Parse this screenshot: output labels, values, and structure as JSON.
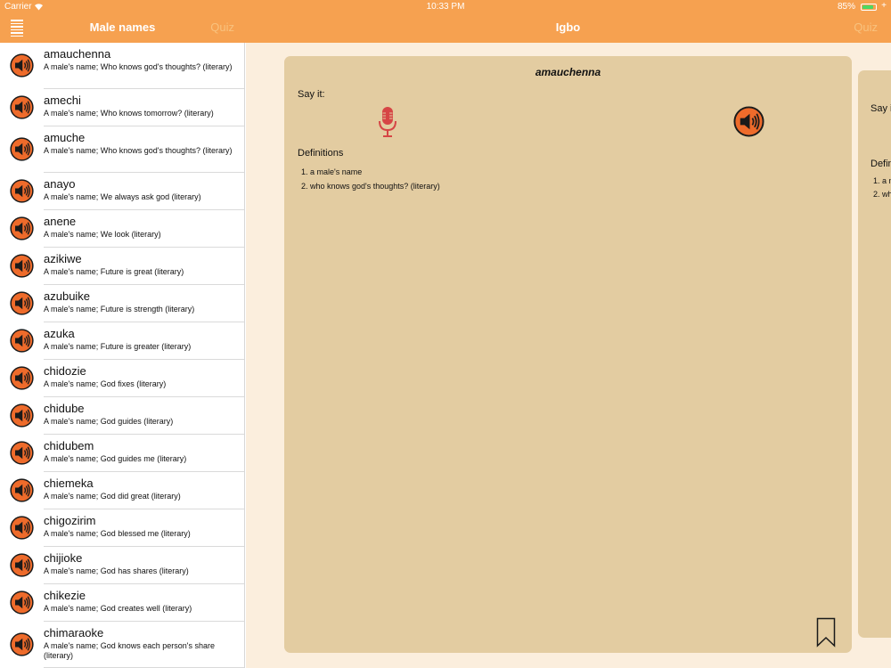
{
  "status_bar": {
    "carrier": "Carrier",
    "time": "10:33 PM",
    "battery": "85%",
    "battery_level": 0.85
  },
  "master": {
    "title": "Male names",
    "quiz_label": "Quiz"
  },
  "detail": {
    "title": "Igbo",
    "quiz_label": "Quiz"
  },
  "colors": {
    "accent": "#f6a150",
    "card": "#e3cca1",
    "detail_bg": "#fbeedd",
    "mic": "#d64545",
    "speaker": "#ee6b2b",
    "battery": "#4cd964"
  },
  "names": [
    {
      "name": "amauchenna",
      "desc": "A male's name; Who knows god's thoughts? (literary)"
    },
    {
      "name": "amechi",
      "desc": "A male's name; Who knows tomorrow? (literary)"
    },
    {
      "name": "amuche",
      "desc": "A male's name; Who knows god's thoughts? (literary)"
    },
    {
      "name": "anayo",
      "desc": "A male's name; We always ask god (literary)"
    },
    {
      "name": "anene",
      "desc": "A male's name; We look (literary)"
    },
    {
      "name": "azikiwe",
      "desc": "A male's name; Future is great (literary)"
    },
    {
      "name": "azubuike",
      "desc": "A male's name; Future is strength (literary)"
    },
    {
      "name": "azuka",
      "desc": "A male's name; Future is greater (literary)"
    },
    {
      "name": "chidozie",
      "desc": "A male's name; God fixes (literary)"
    },
    {
      "name": "chidube",
      "desc": "A male's name; God guides (literary)"
    },
    {
      "name": "chidubem",
      "desc": "A male's name; God guides me (literary)"
    },
    {
      "name": "chiemeka",
      "desc": "A male's name; God did great (literary)"
    },
    {
      "name": "chigozirim",
      "desc": "A male's name; God blessed me (literary)"
    },
    {
      "name": "chijioke",
      "desc": "A male's name; God has shares (literary)"
    },
    {
      "name": "chikezie",
      "desc": "A male's name; God creates well (literary)"
    },
    {
      "name": "chimaraoke",
      "desc": "A male's name; God knows each person's share (literary)"
    }
  ],
  "card": {
    "word": "amauchenna",
    "say_label": "Say it:",
    "definitions_label": "Definitions",
    "definitions": [
      "1. a male's name",
      "2. who knows god's thoughts? (literary)"
    ]
  },
  "card_next": {
    "say_label": "Say i",
    "definitions_label": "Defin",
    "definitions": [
      "1. a n",
      "2. wh"
    ]
  },
  "icons": {
    "menu": "list-menu-icon",
    "speaker": "speaker-icon",
    "mic": "microphone-icon",
    "bookmark": "bookmark-icon",
    "wifi": "wifi-icon",
    "battery": "battery-icon"
  }
}
